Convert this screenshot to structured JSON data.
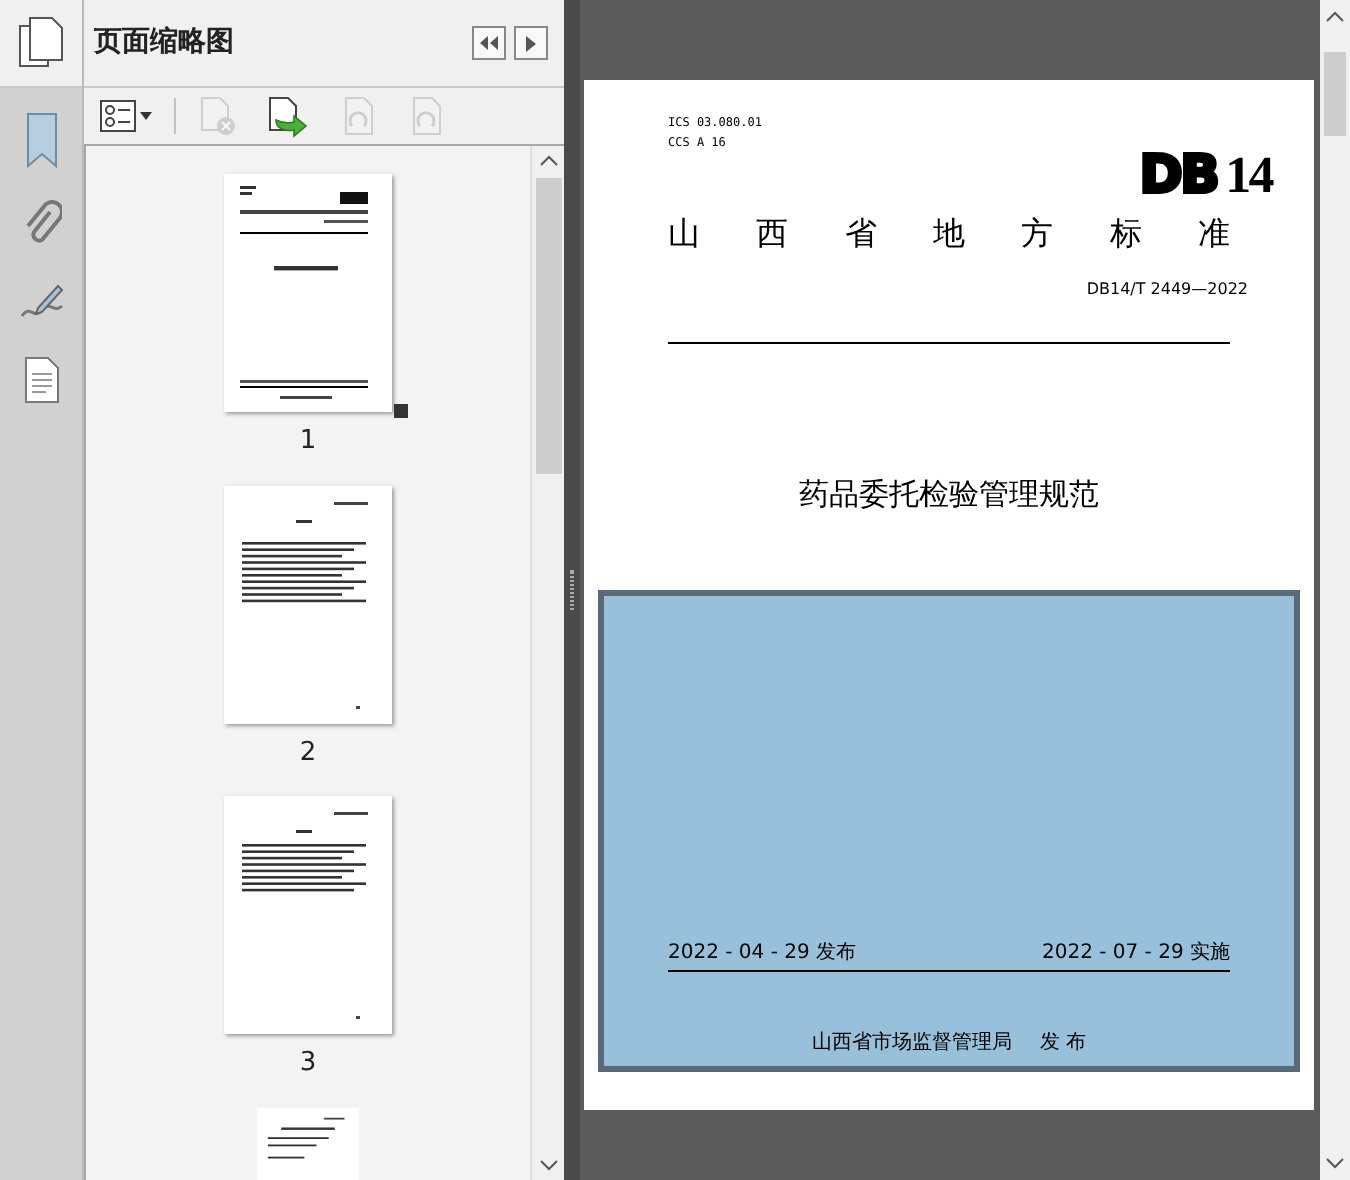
{
  "panel": {
    "title": "页面缩略图"
  },
  "toolbar": [
    {
      "kind": "options",
      "disabled": false
    },
    {
      "kind": "delete",
      "disabled": true
    },
    {
      "kind": "insert",
      "disabled": false
    },
    {
      "kind": "rotate-left",
      "disabled": true
    },
    {
      "kind": "rotate-right",
      "disabled": true
    }
  ],
  "thumbnails": [
    {
      "label": "1",
      "kind": "cover",
      "selected": true
    },
    {
      "label": "2",
      "kind": "contents",
      "selected": false
    },
    {
      "label": "3",
      "kind": "text",
      "selected": false
    }
  ],
  "document": {
    "ics": "ICS 03.080.01",
    "ccs": "CCS A 16",
    "logo_prefix": "DB",
    "logo_number": "14",
    "heading": "山西省地方标准",
    "code": "DB14/T 2449—2022",
    "title": "药品委托检验管理规范",
    "release_date": "2022 - 04 - 29 发布",
    "implement_date": "2022 - 07 - 29 实施",
    "issuer": "山西省市场监督管理局",
    "issuer_action": "发 布"
  }
}
